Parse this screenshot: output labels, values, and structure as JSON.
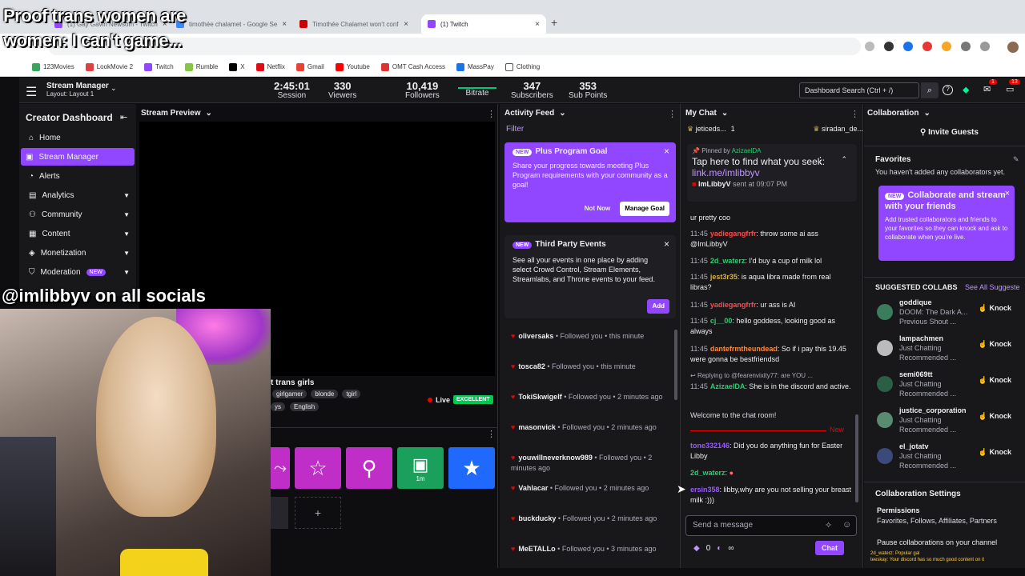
{
  "browser": {
    "tabs": [
      {
        "label": "(1) Gay Gavin Newsom - Twitch",
        "active": false
      },
      {
        "label": "timothée chalamet - Google Se",
        "active": false
      },
      {
        "label": "Timothée Chalamet won't conf",
        "active": false
      },
      {
        "label": "(1) Twitch",
        "active": true
      }
    ],
    "new_tab": "+",
    "bookmarks": [
      "123Movies",
      "LookMovie 2",
      "Twitch",
      "Rumble",
      "X",
      "Netflix",
      "Gmail",
      "Youtube",
      "OMT Cash Access",
      "MassPay",
      "Clothing"
    ]
  },
  "overlay": {
    "title": "Proof trans women are\nwomen: I can't game...",
    "socials": "@imlibbyv on all socials"
  },
  "topbar": {
    "menu_label": "Stream Manager",
    "layout": "Layout: Layout 1",
    "stats": [
      {
        "value": "2:45:01",
        "label": "Session"
      },
      {
        "value": "330",
        "label": "Viewers"
      },
      {
        "value": "10,419",
        "label": "Followers"
      },
      {
        "value": "",
        "label": "Bitrate"
      },
      {
        "value": "347",
        "label": "Subscribers"
      },
      {
        "value": "353",
        "label": "Sub Points"
      }
    ],
    "search_placeholder": "Dashboard Search (Ctrl + /)",
    "notif_count": "1",
    "inbox_count": "13"
  },
  "sidebar": {
    "title": "Creator Dashboard",
    "items": [
      {
        "label": "Home",
        "icon": "home-icon"
      },
      {
        "label": "Stream Manager",
        "icon": "stream-icon",
        "active": true
      },
      {
        "label": "Alerts",
        "icon": "bell-icon"
      },
      {
        "label": "Analytics",
        "icon": "chart-icon"
      },
      {
        "label": "Community",
        "icon": "community-icon"
      },
      {
        "label": "Content",
        "icon": "content-icon"
      },
      {
        "label": "Monetization",
        "icon": "money-icon"
      },
      {
        "label": "Moderation",
        "icon": "shield-icon",
        "badge": "NEW"
      }
    ]
  },
  "preview": {
    "title": "Stream Preview",
    "stream_title_fragment": "t trans girls",
    "tags": [
      "girlgamer",
      "blonde",
      "tgirl"
    ],
    "tags2_fragment": "ys",
    "language": "English",
    "live_label": "Live",
    "quality": "EXCELLENT",
    "quick_action_counter": "1m",
    "add": "+"
  },
  "activity": {
    "title": "Activity Feed",
    "filter": "Filter",
    "plus_card": {
      "badge": "NEW",
      "title": "Plus Program Goal",
      "body": "Share your progress towards meeting Plus Program requirements with your community as a goal!",
      "not_now": "Not Now",
      "manage": "Manage Goal"
    },
    "third_party": {
      "badge": "NEW",
      "title": "Third Party Events",
      "body": "See all your events in one place by adding select Crowd Control, Stream Elements, Streamlabs, and Throne events to your feed.",
      "add": "Add"
    },
    "follows": [
      {
        "user": "oliversaks",
        "text": "Followed you • this minute"
      },
      {
        "user": "tosca82",
        "text": "Followed you • this minute"
      },
      {
        "user": "TokiSkwigelf",
        "text": "Followed you • 2 minutes ago"
      },
      {
        "user": "masonvick",
        "text": "Followed you • 2 minutes ago"
      },
      {
        "user": "youwillneverknow989",
        "text": "Followed you • 2 minutes ago"
      },
      {
        "user": "Vahlacar",
        "text": "Followed you • 2 minutes ago"
      },
      {
        "user": "buckducky",
        "text": "Followed you • 2 minutes ago"
      },
      {
        "user": "MeETALLo",
        "text": "Followed you • 3 minutes ago"
      }
    ]
  },
  "chat": {
    "title": "My Chat",
    "top_users": [
      "jeticeds...",
      "1",
      "siradan_de..."
    ],
    "pinned_by": "Pinned by",
    "pinned_user": "AzizaelDA",
    "pinned_text": "Tap here to find what you seek:",
    "pinned_link": "link.me/imlibbyv",
    "pinned_sender": "ImLibbyV",
    "pinned_time": "sent at 09:07 PM",
    "partial_line": "ur pretty coo",
    "messages": [
      {
        "time": "11:45",
        "user": "yadiegangfrfr",
        "color": "#ff4a4a",
        "text": ": throw some ai ass @ImLibbyV"
      },
      {
        "time": "11:45",
        "user": "2d_waterz",
        "color": "#2ecc71",
        "text": ": I'd buy a cup of milk lol"
      },
      {
        "time": "11:45",
        "user": "jest3r35",
        "color": "#d2b04c",
        "text": ": is aqua libra made from real libras?"
      },
      {
        "time": "11:45",
        "user": "yadiegangfrfr",
        "color": "#ff4a4a",
        "text": ": ur ass is AI"
      },
      {
        "time": "11:45",
        "user": "cj__00",
        "color": "#2ecc71",
        "text": ": hello goddess, looking good as always"
      },
      {
        "time": "11:45",
        "user": "dantefrmtheundead",
        "color": "#ff8a3d",
        "text": ": So if i pay this 19.45 were gonna be bestfriendsd"
      }
    ],
    "reply_to": "Replying to @fearenvixity77: are YOU ...",
    "reply_msg": {
      "time": "11:45",
      "user": "AzizaelDA",
      "color": "#2ecc71",
      "text": ": She is in the discord and active."
    },
    "welcome": "Welcome to the chat room!",
    "new_label": "New",
    "recent": [
      {
        "user": "tone332146",
        "color": "#9b59ff",
        "text": ": Did you do anything fun for Easter Libby"
      },
      {
        "user": "2d_waterz",
        "color": "#2ecc71",
        "text": ":"
      },
      {
        "user": "ersin358",
        "color": "#9b59ff",
        "text": ": libby,why are you not selling your breast milk :)))"
      }
    ],
    "input_placeholder": "Send a message",
    "points": "0",
    "chat_button": "Chat",
    "overlay_lines": [
      "2d_waterz: Popular gal",
      "teeskay: Your discord has so much good content on it"
    ]
  },
  "collab": {
    "title": "Collaboration",
    "invite": "Invite Guests",
    "favorites": "Favorites",
    "favorites_empty": "You haven't added any collaborators yet.",
    "card_badge": "NEW",
    "card_title": "Collaborate and stream with your friends",
    "card_body": "Add trusted collaborators and friends to your favorites so they can knock and ask to collaborate when you're live.",
    "suggested": "SUGGESTED COLLABS",
    "see_all": "See All Suggeste",
    "knock": "Knock",
    "collabs": [
      {
        "name": "goddique",
        "game": "DOOM: The Dark A...",
        "sub": "Previous Shout ..."
      },
      {
        "name": "lampachmen",
        "game": "Just Chatting",
        "sub": "Recommended ..."
      },
      {
        "name": "semi069tt",
        "game": "Just Chatting",
        "sub": "Recommended ..."
      },
      {
        "name": "justice_corporation",
        "game": "Just Chatting",
        "sub": "Recommended ..."
      },
      {
        "name": "el_jotatv",
        "game": "Just Chatting",
        "sub": "Recommended ..."
      }
    ],
    "settings": "Collaboration Settings",
    "permissions": "Permissions",
    "permissions_value": "Favorites, Follows, Affiliates, Partners",
    "pause": "Pause collaborations on your channel"
  }
}
